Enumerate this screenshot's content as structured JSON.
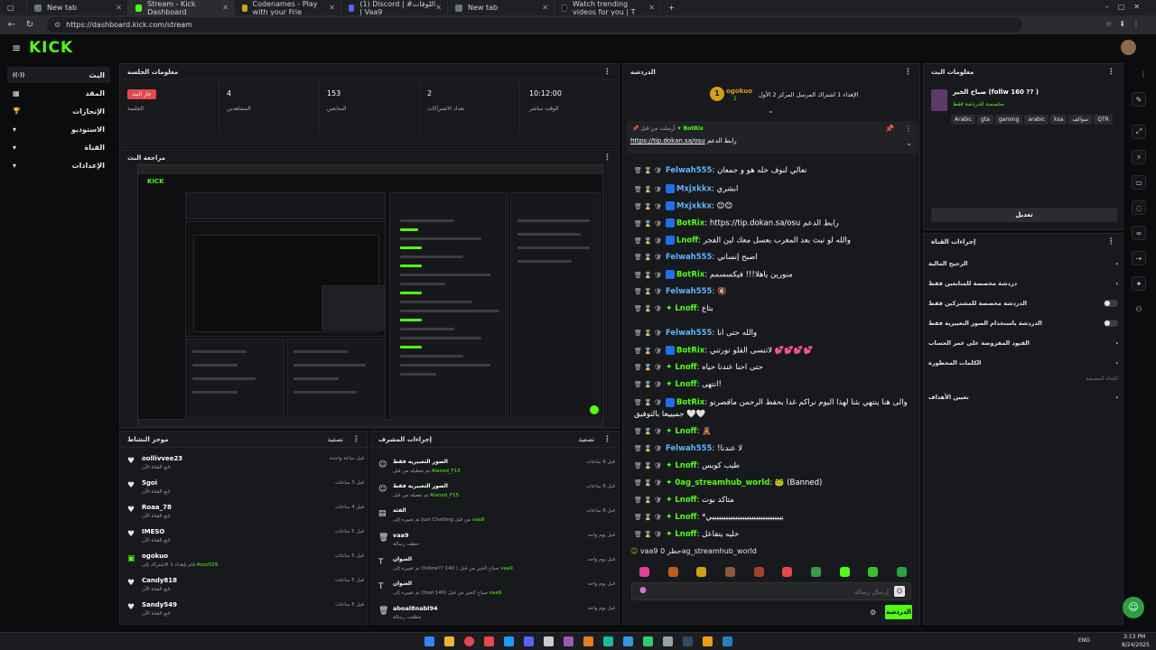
{
  "browser": {
    "tabs": [
      {
        "title": "New tab",
        "active": false
      },
      {
        "title": "Stream - Kick Dashboard",
        "active": true
      },
      {
        "title": "Codenames - Play with your Frie",
        "active": false
      },
      {
        "title": "(1) Discord | #اللوقات | Vaa9",
        "active": false
      },
      {
        "title": "New tab",
        "active": false
      },
      {
        "title": "Watch trending videos for you | T",
        "active": false
      }
    ],
    "new_tab": "+",
    "url": "https://dashboard.kick.com/stream"
  },
  "header": {
    "logo": "KICK"
  },
  "sidebar": {
    "items": [
      {
        "label": "البث",
        "icon": "((·))"
      },
      {
        "label": "المقد",
        "icon": "▦"
      },
      {
        "label": "الإنجازات",
        "icon": "🏆"
      },
      {
        "label": "الاستوديو",
        "icon": "▾"
      },
      {
        "label": "القناة",
        "icon": "▾"
      },
      {
        "label": "الإعدادات",
        "icon": "▾"
      }
    ]
  },
  "session": {
    "title": "معلومات الجلسة",
    "stats": [
      {
        "value": "جار البث",
        "label": "الجلسة"
      },
      {
        "value": "4",
        "label": "المشاهدين"
      },
      {
        "value": "153",
        "label": "المتابعين"
      },
      {
        "value": "2",
        "label": "تعداد الاشتراكات"
      },
      {
        "value": "10:12:00",
        "label": "الوقت مباشر"
      }
    ]
  },
  "preview": {
    "title": "مراجعة البث"
  },
  "activity": {
    "title": "موجز النشاط",
    "filter": "تصفية",
    "items": [
      {
        "user": "oollivvee23",
        "desc": "تابع القناة الآن",
        "time": "قبل ساعة واحدة"
      },
      {
        "user": "5goi",
        "desc": "تابع القناة الآن",
        "time": "قبل 3 ساعات"
      },
      {
        "user": "Roaa_78",
        "desc": "تابع القناة الآن",
        "time": "قبل 4 ساعات"
      },
      {
        "user": "IMESO",
        "desc": "تابع القناة الآن",
        "time": "قبل 5 ساعات"
      },
      {
        "user": "ogokuo",
        "desc": "قام بإهداء 1 الاشتراك إلى",
        "target": "Azoz029",
        "time": "قبل 5 ساعات"
      },
      {
        "user": "Candy818",
        "desc": "تابع القناة الآن",
        "time": "قبل 5 ساعات"
      },
      {
        "user": "Sandy549",
        "desc": "تابع القناة الآن",
        "time": "قبل 5 ساعات"
      }
    ]
  },
  "modactions": {
    "title": "إجراءات المشرف",
    "filter": "تصفية",
    "items": [
      {
        "action": "الصور التعبيرية فقط",
        "detail": "تم تعطيله من قبل",
        "user": "Alanod_F15",
        "time": "قبل 6 ساعات"
      },
      {
        "action": "الصور التعبيرية فقط",
        "detail": "تم تفعيله من قبل",
        "user": "Alanod_F15",
        "time": "قبل 6 ساعات"
      },
      {
        "action": "الفئة",
        "detail": "تم تغييره إلى Just Chatting من قبل",
        "user": "vaa9",
        "time": "قبل 6 ساعات"
      },
      {
        "action": "vaa9",
        "detail": "حظف رسالة",
        "user": "",
        "time": "قبل يوم واحد"
      },
      {
        "action": "العنوان",
        "detail": "تم تغييره إلى (follow?? 140 ) صباح الخير من قبل",
        "user": "vaa9",
        "time": "قبل يوم واحد"
      },
      {
        "action": "العنوان",
        "detail": "تم تغييره إلى (fowl 140) صباح الخير من قبل",
        "user": "vaa9",
        "time": "قبل يوم واحد"
      },
      {
        "action": "aboal8nabl94",
        "detail": "حظفت رسالة",
        "user": "",
        "time": "قبل يوم واحد"
      }
    ]
  },
  "chat": {
    "title": "الدردشة",
    "gifter": {
      "name": "ogokuo",
      "count": "1",
      "text": "الإهداء 1 اشتراك المرسل المركز 2 الأول"
    },
    "pinned": {
      "header": "أرسلت من قبل",
      "user": "BotRix",
      "text": "رابط الدعم",
      "link": "https://tip.dokan.sa/osu"
    },
    "messages": [
      {
        "user": "Felwah555",
        "color": "blue",
        "badge": "none",
        "text": "تعالي لنوف خله هو و جمعان"
      },
      {
        "user": "Mxjxkkx",
        "color": "blue",
        "badge": "mod",
        "text": "ابشري"
      },
      {
        "user": "Mxjxkkx",
        "color": "blue",
        "badge": "mod",
        "text": "😊😊"
      },
      {
        "user": "BotRix",
        "color": "green",
        "badge": "bot",
        "text": "https://tip.dokan.sa/osu رابط الدعم"
      },
      {
        "user": "Lnoff",
        "color": "green",
        "badge": "mod",
        "text": "والله لو تبث بعد المغرب بعسل معك لين الفجر"
      },
      {
        "user": "Felwah555",
        "color": "blue",
        "badge": "none",
        "text": "اصبح إنساني"
      },
      {
        "user": "BotRix",
        "color": "green",
        "badge": "bot",
        "text": "منورين ياهلا!!! فيكسسمم"
      },
      {
        "user": "Felwah555",
        "color": "blue",
        "badge": "none",
        "text": "🔇"
      },
      {
        "user": "Lnoff",
        "color": "green",
        "badge": "vip",
        "text": "بتاع"
      },
      {
        "user": "Felwah555",
        "color": "blue",
        "badge": "none",
        "text": "والله حتى أنا"
      },
      {
        "user": "BotRix",
        "color": "green",
        "badge": "bot",
        "text": "لاتنسى الفلو نورتني 💕💕💕💕"
      },
      {
        "user": "Lnoff",
        "color": "green",
        "badge": "vip",
        "text": "حتى احنا عندنا حياه"
      },
      {
        "user": "Lnoff",
        "color": "green",
        "badge": "vip",
        "text": "انتهى!"
      },
      {
        "user": "BotRix",
        "color": "green",
        "badge": "bot",
        "text": "والى هنا ينتهي بثنا لهذا اليوم نراكم غدا بحفظ الرحمن ماقصرتو جميييعا بالتوفيق 🤍🤍"
      },
      {
        "user": "Lnoff",
        "color": "green",
        "badge": "vip",
        "text": "🧸"
      },
      {
        "user": "Felwah555",
        "color": "blue",
        "badge": "none",
        "text": "!لا عندنا"
      },
      {
        "user": "Lnoff",
        "color": "green",
        "badge": "vip",
        "text": "طيب كويس"
      },
      {
        "user": "0ag_streamhub_world",
        "color": "green",
        "badge": "vip",
        "text": "🐸 (Banned)"
      },
      {
        "user": "Lnoff",
        "color": "green",
        "badge": "vip",
        "text": "متأكد بوت"
      },
      {
        "user": "Lnoff",
        "color": "green",
        "badge": "vip",
        "text": "*يييييييييييييييييييييييييييييييي"
      },
      {
        "user": "Lnoff",
        "color": "green",
        "badge": "vip",
        "text": "خليه يتفاعل"
      }
    ],
    "ban_notice": "vaa9 حظر 0ag_streamhub_world",
    "input_placeholder": "إرسال رسالة",
    "send_button": "الدردشة"
  },
  "streaminfo": {
    "title": "معلومات البث",
    "stream_title": "صباح الخير (follw 160 ?? )",
    "category": "مخصصة للدردشة فقط",
    "tags": [
      "Arabic",
      "gta",
      "gaming",
      "arabic",
      "ksa",
      "سوالف",
      "QTR"
    ],
    "edit_button": "تعديل"
  },
  "channelactions": {
    "title": "إجراءات القناة",
    "rows": [
      {
        "label": "الرجيح المالية",
        "type": "chevron"
      },
      {
        "label": "دردشة مخصصة للمتابعين فقط",
        "type": "chevron"
      },
      {
        "label": "الدردشة مخصصة للمشتركين فقط",
        "type": "toggle"
      },
      {
        "label": "الدردشة باستخدام الصور التعبيرية فقط",
        "type": "toggle"
      },
      {
        "label": "القيود المفروضة على عمر الحساب",
        "type": "chevron"
      },
      {
        "label": "الكلمات المحظورة",
        "type": "chevron"
      }
    ],
    "section_label": "القناة المضيفة",
    "target_row": "تعيين الأهداف"
  },
  "taskbar": {
    "lang": "ENG",
    "time": "3:13 PM",
    "date": "8/24/2025"
  }
}
